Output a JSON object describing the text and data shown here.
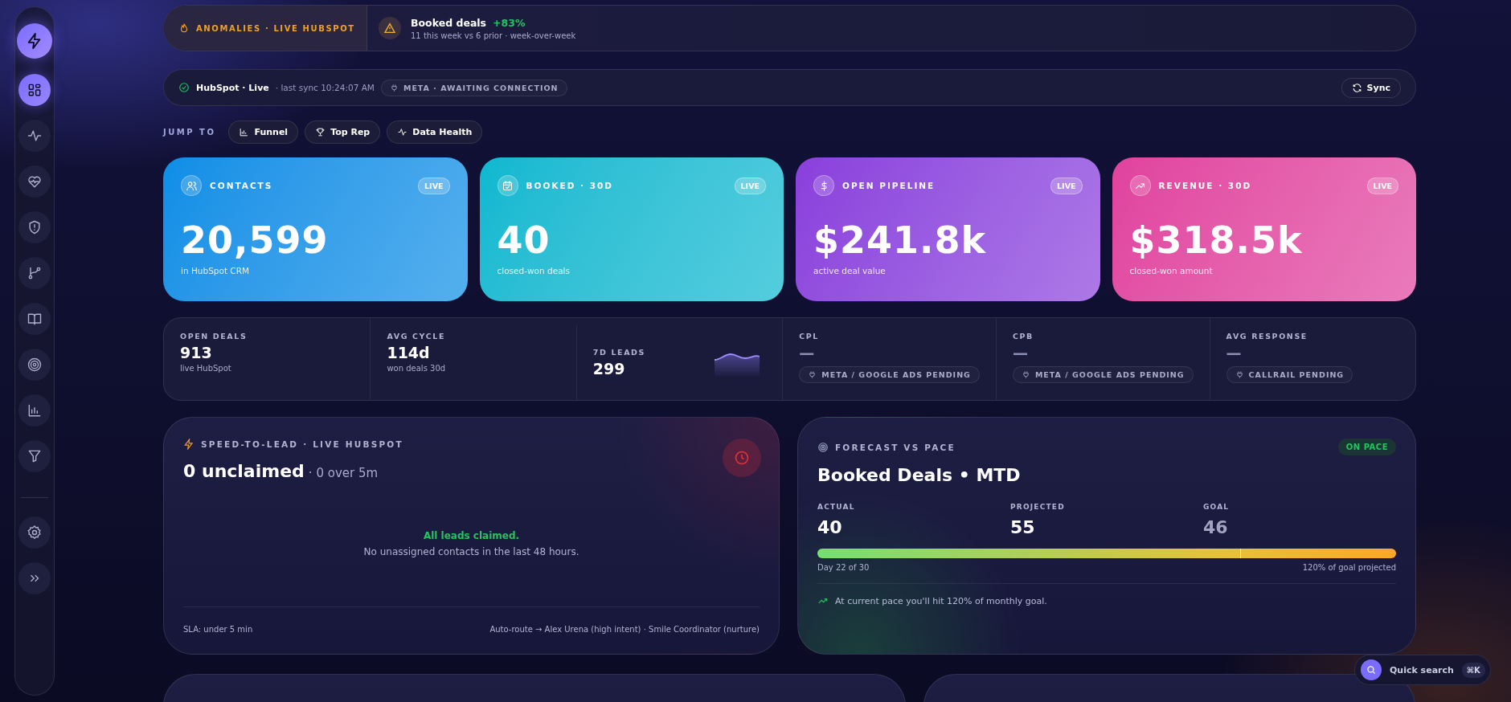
{
  "sidebar": {
    "items": [
      {
        "selected": true
      },
      {
        "selected": false
      },
      {
        "selected": false
      },
      {
        "selected": false
      },
      {
        "selected": false
      },
      {
        "selected": false
      },
      {
        "selected": false
      },
      {
        "selected": false
      },
      {
        "selected": false
      }
    ]
  },
  "anomalies": {
    "label": "ANOMALIES · LIVE HUBSPOT",
    "title": "Booked deals",
    "change": "+83%",
    "detail": "11 this week vs 6 prior · week-over-week"
  },
  "sync_bar": {
    "source": "HubSpot · Live",
    "last_sync": "· last sync 10:24:07 AM",
    "pending": "META · AWAITING CONNECTION",
    "button": "Sync"
  },
  "jump_to": {
    "label": "JUMP TO",
    "links": [
      "Funnel",
      "Top Rep",
      "Data Health"
    ]
  },
  "kpi_cards": [
    {
      "label": "CONTACTS",
      "badge": "LIVE",
      "value": "20,599",
      "caption": "in HubSpot CRM",
      "color": "#0a8ee6"
    },
    {
      "label": "BOOKED · 30D",
      "badge": "LIVE",
      "value": "40",
      "caption": "closed-won deals",
      "color": "#0ab8d0"
    },
    {
      "label": "OPEN PIPELINE",
      "badge": "LIVE",
      "value": "$241.8k",
      "caption": "active deal value",
      "color": "#8a3fdc"
    },
    {
      "label": "REVENUE · 30D",
      "badge": "LIVE",
      "value": "$318.5k",
      "caption": "closed-won amount",
      "color": "#e0429e"
    }
  ],
  "metrics": [
    {
      "kind": "value",
      "label": "OPEN DEALS",
      "value": "913",
      "caption": "live HubSpot"
    },
    {
      "kind": "value",
      "label": "AVG CYCLE",
      "value": "114d",
      "caption": "won deals 30d"
    },
    {
      "kind": "spark",
      "label": "7D LEADS",
      "value": "299"
    },
    {
      "kind": "pending",
      "label": "CPL",
      "value": "—",
      "pill": "META / GOOGLE ADS PENDING"
    },
    {
      "kind": "pending",
      "label": "CPB",
      "value": "—",
      "pill": "META / GOOGLE ADS PENDING"
    },
    {
      "kind": "pending",
      "label": "AVG RESPONSE",
      "value": "—",
      "pill": "CALLRAIL PENDING"
    }
  ],
  "speed_to_lead": {
    "label": "SPEED-TO-LEAD · LIVE HUBSPOT",
    "headline": "0 unclaimed",
    "sub": "· 0 over 5m",
    "empty_title": "All leads claimed.",
    "empty_text": "No unassigned contacts in the last 48 hours.",
    "sla": "SLA: under 5 min",
    "routing": "Auto-route → Alex Urena (high intent) · Smile Coordinator (nurture)"
  },
  "forecast": {
    "label": "FORECAST VS PACE",
    "status": "ON PACE",
    "title": "Booked Deals • MTD",
    "stats": [
      {
        "label": "ACTUAL",
        "value": "40",
        "muted": false
      },
      {
        "label": "PROJECTED",
        "value": "55",
        "muted": false
      },
      {
        "label": "GOAL",
        "value": "46",
        "muted": true
      }
    ],
    "pace_bar": {
      "level": 1
    },
    "day_progress": {
      "label": "Day 22 of 30",
      "level": 0.73
    },
    "projection": "120% of goal projected",
    "note": "At current pace you'll hit 120% of monthly goal."
  },
  "quick_search": {
    "label": "Quick search",
    "shortcut": "⌘K"
  }
}
